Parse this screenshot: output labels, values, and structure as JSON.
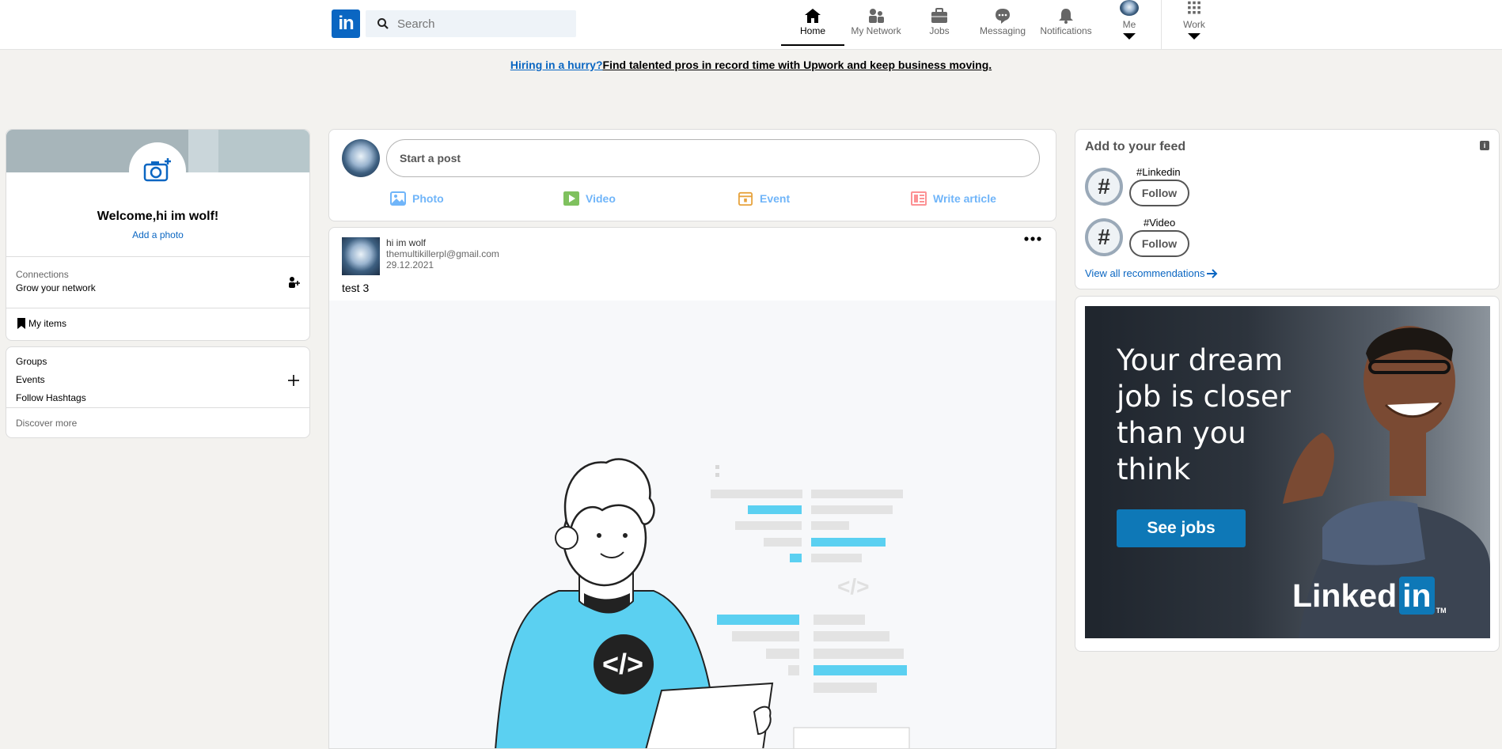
{
  "nav": {
    "logo": "in",
    "search_placeholder": "Search",
    "items": [
      {
        "label": "Home",
        "icon": "home-icon"
      },
      {
        "label": "My Network",
        "icon": "network-icon"
      },
      {
        "label": "Jobs",
        "icon": "briefcase-icon"
      },
      {
        "label": "Messaging",
        "icon": "messaging-icon"
      },
      {
        "label": "Notifications",
        "icon": "bell-icon"
      },
      {
        "label": "Me",
        "icon": "avatar-icon"
      },
      {
        "label": "Work",
        "icon": "grid-icon"
      }
    ]
  },
  "promo": {
    "link": "Hiring in a hurry?",
    "text": "Find talented pros in record time with Upwork and keep business moving."
  },
  "profile": {
    "welcome": "Welcome,hi im wolf!",
    "add_photo": "Add a photo",
    "connections_label": "Connections",
    "connections_sub": "Grow your network",
    "my_items": "My items"
  },
  "community": {
    "groups": "Groups",
    "events": "Events",
    "hashtags": "Follow Hashtags",
    "discover": "Discover more"
  },
  "composer": {
    "placeholder": "Start a post",
    "actions": [
      {
        "label": "Photo",
        "color": "#70b5f9"
      },
      {
        "label": "Video",
        "color": "#7fc15e"
      },
      {
        "label": "Event",
        "color": "#e7a33e"
      },
      {
        "label": "Write article",
        "color": "#fc9295"
      }
    ]
  },
  "post": {
    "author": "hi im wolf",
    "email": "themultikillerpl@gmail.com",
    "date": "29.12.2021",
    "text": "test 3",
    "code_glyph": "</>",
    "code_glyph_small": "</>"
  },
  "feed": {
    "title": "Add to your feed",
    "info_badge": "i",
    "recommendations": [
      {
        "tag": "#Linkedin",
        "button": "Follow"
      },
      {
        "tag": "#Video",
        "button": "Follow"
      }
    ],
    "view_all": "View all recommendations"
  },
  "ad": {
    "headline_lines": [
      "Your dream",
      "job is closer",
      "than you",
      "think"
    ],
    "button": "See jobs",
    "brand": "Linked",
    "brand_in": "in",
    "tm": "TM"
  },
  "colors": {
    "brand": "#0a66c2",
    "background": "#f3f2ef",
    "illustration_accent": "#5bd0f1"
  }
}
